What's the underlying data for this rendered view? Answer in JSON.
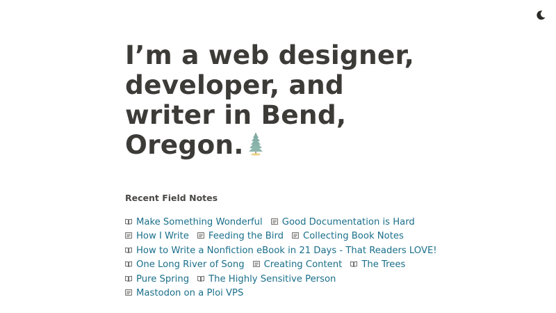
{
  "hero": {
    "headline": "I’m a web designer, developer, and writer in Bend, Oregon."
  },
  "theme_toggle": {
    "icon": "moon-icon"
  },
  "field_notes": {
    "title": "Recent Field Notes",
    "items": [
      {
        "label": "Make Something Wonderful",
        "icon": "open-book-icon"
      },
      {
        "label": "Good Documentation is Hard",
        "icon": "document-icon"
      },
      {
        "label": "How I Write",
        "icon": "document-icon"
      },
      {
        "label": "Feeding the Bird",
        "icon": "document-icon"
      },
      {
        "label": "Collecting Book Notes",
        "icon": "document-icon"
      },
      {
        "label": "How to Write a Nonfiction eBook in 21 Days - That Readers LOVE!",
        "icon": "open-book-icon"
      },
      {
        "label": "One Long River of Song",
        "icon": "open-book-icon"
      },
      {
        "label": "Creating Content",
        "icon": "document-icon"
      },
      {
        "label": "The Trees",
        "icon": "open-book-icon"
      },
      {
        "label": "Pure Spring",
        "icon": "open-book-icon"
      },
      {
        "label": "The Highly Sensitive Person",
        "icon": "open-book-icon"
      },
      {
        "label": "Mastodon on a Ploi VPS",
        "icon": "document-icon"
      }
    ]
  },
  "colors": {
    "text": "#3d3b38",
    "link": "#1a6f8a",
    "background": "#ffffff"
  }
}
